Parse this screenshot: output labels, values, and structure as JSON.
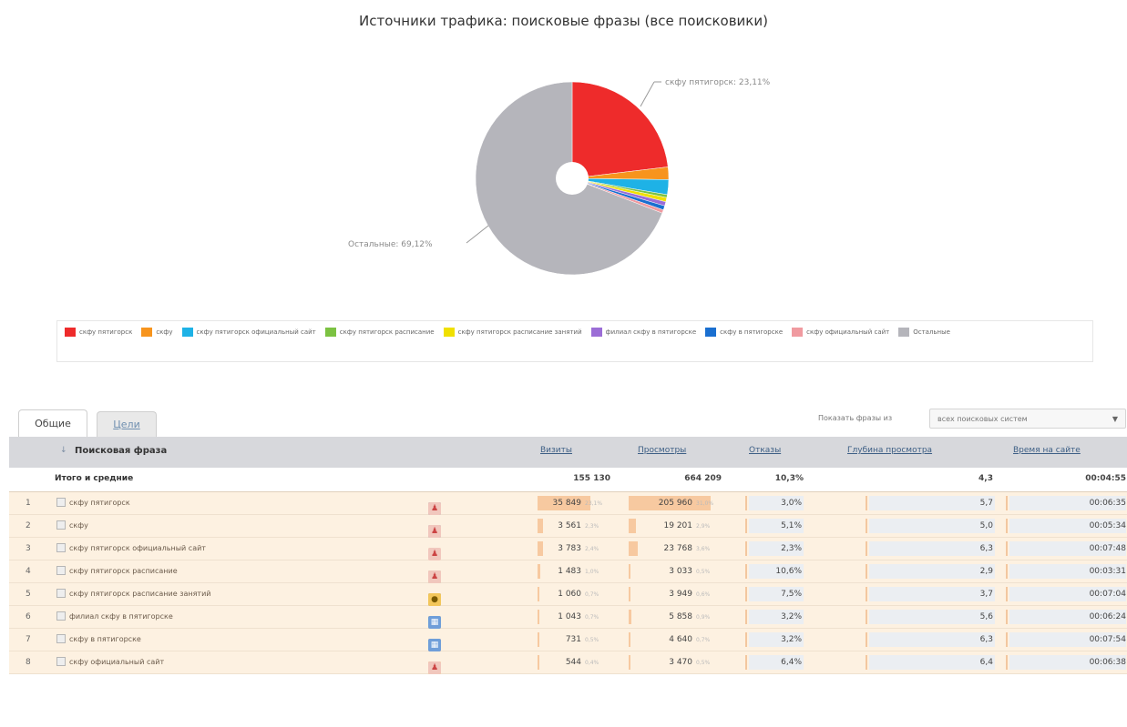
{
  "page_title": "Источники трафика: поисковые фразы (все поисковики)",
  "chart_data": {
    "type": "pie",
    "slices": [
      {
        "label": "скфу пятигорск",
        "value": 23.11,
        "color": "#ee2b2b"
      },
      {
        "label": "скфу",
        "value": 2.1,
        "color": "#f7941d"
      },
      {
        "label": "скфу пятигорск официальный сайт",
        "value": 2.5,
        "color": "#1eb2e6"
      },
      {
        "label": "скфу пятигорск расписание",
        "value": 0.5,
        "color": "#7cc242"
      },
      {
        "label": "скфу пятигорск расписание занятий",
        "value": 0.7,
        "color": "#f0e000"
      },
      {
        "label": "филиал скфу в пятигорске",
        "value": 0.7,
        "color": "#9b6dd6"
      },
      {
        "label": "скфу в пятигорске",
        "value": 0.7,
        "color": "#1a6fd0"
      },
      {
        "label": "скфу официальный сайт",
        "value": 0.56,
        "color": "#f09aa0"
      },
      {
        "label": "Остальные",
        "value": 69.12,
        "color": "#b5b5bb"
      }
    ],
    "callouts": {
      "top": "скфу пятигорск: 23,11%",
      "left": "Остальные: 69,12%"
    }
  },
  "tabs": {
    "general": "Общие",
    "goals": "Цели"
  },
  "filter": {
    "label": "Показать фразы из",
    "value": "всех поисковых систем"
  },
  "table": {
    "headers": {
      "phrase": "Поисковая фраза",
      "visits": "Визиты",
      "views": "Просмотры",
      "bounces": "Отказы",
      "depth": "Глубина просмотра",
      "time": "Время на сайте"
    },
    "total": {
      "label": "Итого и средние",
      "visits": "155 130",
      "views": "664 209",
      "bounces": "10,3%",
      "depth": "4,3",
      "time": "00:04:55"
    },
    "rows": [
      {
        "idx": "1",
        "phrase": "скфу пятигорск",
        "visits": "35 849",
        "visits_pct": "23,1%",
        "views": "205 960",
        "views_pct": "31,0%",
        "bounces": "3,0%",
        "depth": "5,7",
        "time": "00:06:35",
        "icons": [
          "ic-red",
          "ic-yellow",
          "ic-red",
          "ic-blue",
          "ic-red"
        ]
      },
      {
        "idx": "2",
        "phrase": "скфу",
        "visits": "3 561",
        "visits_pct": "2,3%",
        "views": "19 201",
        "views_pct": "2,9%",
        "bounces": "5,1%",
        "depth": "5,0",
        "time": "00:05:34",
        "icons": [
          "ic-red",
          "ic-red",
          "ic-yellow",
          "ic-blue",
          "ic-red"
        ]
      },
      {
        "idx": "3",
        "phrase": "скфу пятигорск официальный сайт",
        "visits": "3 783",
        "visits_pct": "2,4%",
        "views": "23 768",
        "views_pct": "3,6%",
        "bounces": "2,3%",
        "depth": "6,3",
        "time": "00:07:48",
        "icons": [
          "ic-red",
          "ic-red",
          "ic-yellow",
          "ic-house",
          "ic-red"
        ]
      },
      {
        "idx": "4",
        "phrase": "скфу пятигорск расписание",
        "visits": "1 483",
        "visits_pct": "1,0%",
        "views": "3 033",
        "views_pct": "0,5%",
        "bounces": "10,6%",
        "depth": "2,9",
        "time": "00:03:31",
        "icons": [
          "ic-red",
          "ic-red",
          "ic-blue",
          "ic-yellow",
          "ic-red"
        ]
      },
      {
        "idx": "5",
        "phrase": "скфу пятигорск расписание занятий",
        "visits": "1 060",
        "visits_pct": "0,7%",
        "views": "3 949",
        "views_pct": "0,6%",
        "bounces": "7,5%",
        "depth": "3,7",
        "time": "00:07:04",
        "icons": [
          "ic-red",
          "ic-red",
          "ic-yellow",
          "ic-blue",
          "ic-bulb"
        ]
      },
      {
        "idx": "6",
        "phrase": "филиал скфу в пятигорске",
        "visits": "1 043",
        "visits_pct": "0,7%",
        "views": "5 858",
        "views_pct": "0,9%",
        "bounces": "3,2%",
        "depth": "5,6",
        "time": "00:06:24",
        "icons": [
          "ic-red",
          "ic-red",
          "ic-red",
          "ic-yellow",
          "ic-blue"
        ]
      },
      {
        "idx": "7",
        "phrase": "скфу в пятигорске",
        "visits": "731",
        "visits_pct": "0,5%",
        "views": "4 640",
        "views_pct": "0,7%",
        "bounces": "3,2%",
        "depth": "6,3",
        "time": "00:07:54",
        "icons": [
          "ic-red",
          "ic-red",
          "ic-yellow",
          "ic-red",
          "ic-blue"
        ]
      },
      {
        "idx": "8",
        "phrase": "скфу официальный сайт",
        "visits": "544",
        "visits_pct": "0,4%",
        "views": "3 470",
        "views_pct": "0,5%",
        "bounces": "6,4%",
        "depth": "6,4",
        "time": "00:06:38",
        "icons": [
          "ic-red",
          "ic-red",
          "ic-yellow",
          "ic-bulb",
          "ic-red"
        ]
      }
    ]
  }
}
